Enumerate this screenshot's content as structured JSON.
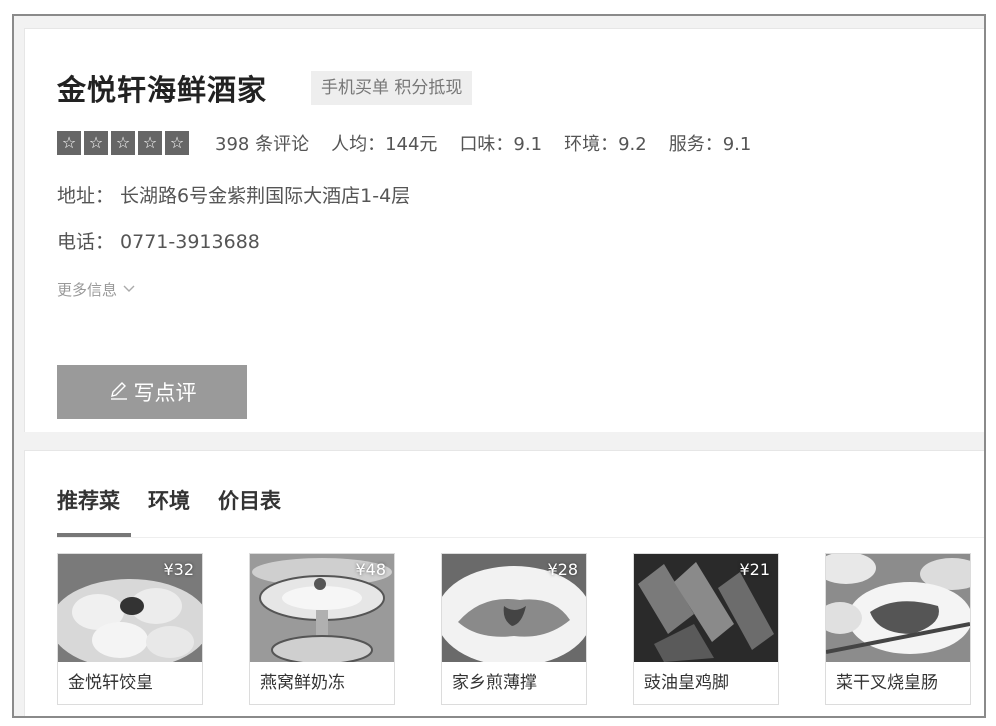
{
  "shop": {
    "name": "金悦轩海鲜酒家",
    "tag": "手机买单 积分抵现",
    "star_glyph": "☆",
    "reviews": "398 条评论",
    "avg_price": "人均：144元",
    "taste": "口味：9.1",
    "environment": "环境：9.2",
    "service": "服务：9.1",
    "address": "地址： 长湖路6号金紫荆国际大酒店1-4层",
    "phone": "电话： 0771-3913688",
    "more_info": "更多信息",
    "review_button": "写点评"
  },
  "tabs": [
    {
      "label": "推荐菜"
    },
    {
      "label": "环境"
    },
    {
      "label": "价目表"
    }
  ],
  "dishes": [
    {
      "name": "金悦轩饺皇",
      "price": "¥32"
    },
    {
      "name": "燕窝鲜奶冻",
      "price": "¥48"
    },
    {
      "name": "家乡煎薄撑",
      "price": "¥28"
    },
    {
      "name": "豉油皇鸡脚",
      "price": "¥21"
    },
    {
      "name": "菜干叉烧皇肠",
      "price": ""
    }
  ]
}
